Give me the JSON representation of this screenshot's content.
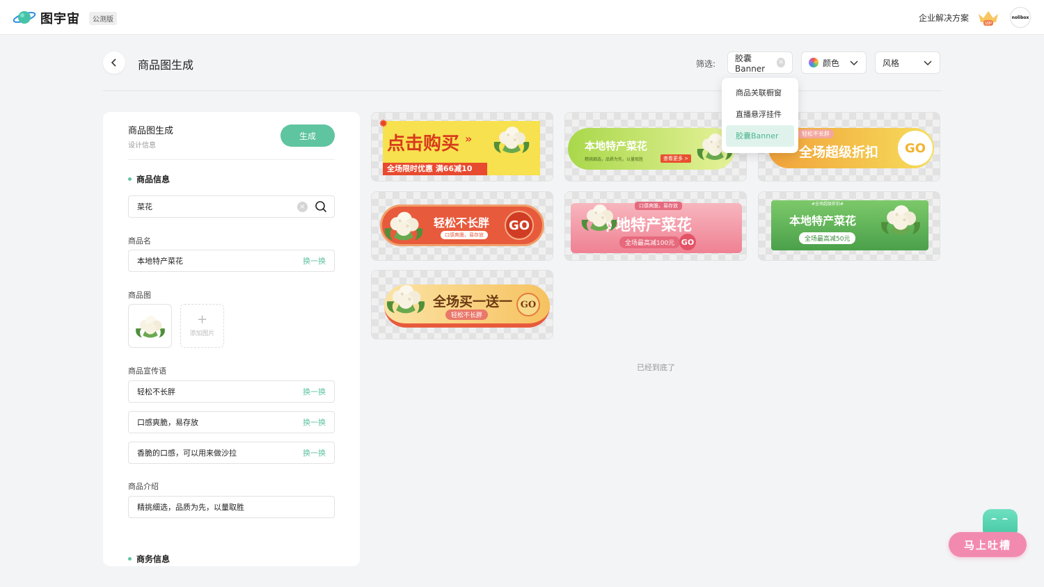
{
  "app": {
    "name": "图宇宙",
    "badge": "公测版"
  },
  "topnav": {
    "enterprise": "企业解决方案",
    "vip": "VIP",
    "avatar_text": "nolibox"
  },
  "page": {
    "title": "商品图生成",
    "filter_label": "筛选:"
  },
  "filters": {
    "type": {
      "value": "胶囊Banner"
    },
    "color": {
      "value": "颜色"
    },
    "style": {
      "value": "风格"
    }
  },
  "dropdown": {
    "items": [
      "商品关联橱窗",
      "直播悬浮挂件",
      "胶囊Banner"
    ],
    "selected": "胶囊Banner"
  },
  "panel": {
    "title": "商品图生成",
    "subtitle": "设计信息",
    "generate": "生成",
    "section_product": "商品信息",
    "search_value": "菜花",
    "name_label": "商品名",
    "name_value": "本地特产菜花",
    "swap": "换一换",
    "image_label": "商品图",
    "add_image": "添加图片",
    "slogan_label": "商品宣传语",
    "slogans": [
      "轻松不长胖",
      "口感爽脆，易存放",
      "香脆的口感，可以用来做沙拉"
    ],
    "intro_label": "商品介绍",
    "intro_value": "精挑细选，品质为先，以量取胜",
    "section_business": "商务信息"
  },
  "cards": [
    {
      "title": "点击购买",
      "sub": "全场限时优惠 满66减10"
    },
    {
      "title": "本地特产菜花",
      "sub": "精挑细选，品质为先，以量取胜",
      "cta": "查看更多 >"
    },
    {
      "title": "全场超级折扣",
      "tag": "轻松不长胖",
      "go": "GO"
    },
    {
      "title": "轻松不长胖",
      "sub": "口感爽脆，易存放",
      "go": "GO"
    },
    {
      "title": "本地特产菜花",
      "tag": "口感爽脆，易存放",
      "sub": "全场最高减100元",
      "go": "GO"
    },
    {
      "title": "本地特产菜花",
      "tag": "#全场超级折扣#",
      "sub": "全场最高减50元"
    },
    {
      "title": "全场买一送一",
      "sub": "轻松不长胖",
      "go": "GO"
    }
  ],
  "bottom_note": "已经到底了",
  "feedback": {
    "label": "马上吐槽"
  },
  "colors": {
    "accent": "#5fc4a0",
    "feedback": "#f28ab0"
  }
}
